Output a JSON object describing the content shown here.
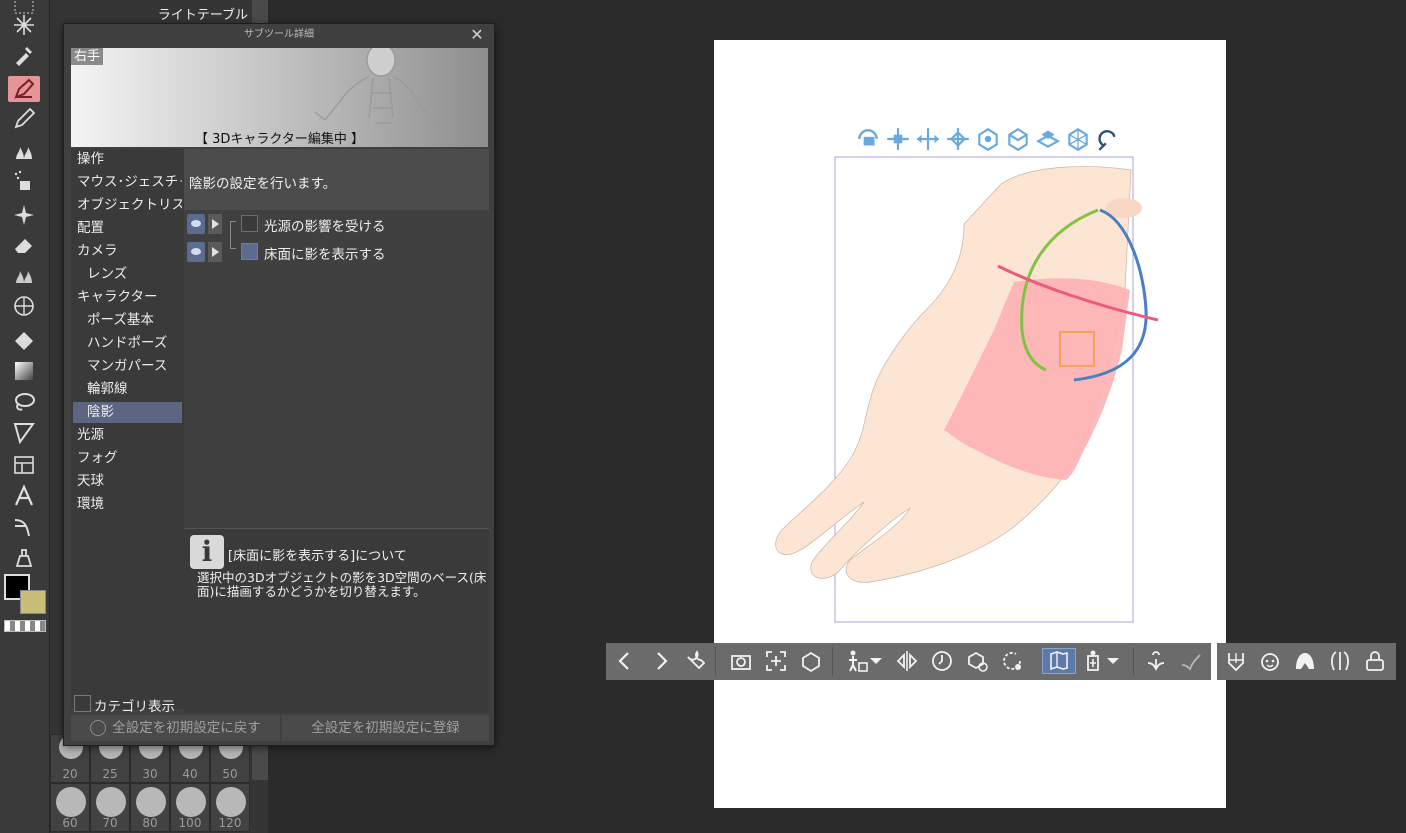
{
  "subtool_panel": {
    "light_table_label": "ライトテーブル",
    "brush_sizes_row1": [
      "20",
      "25",
      "30",
      "40",
      "50"
    ],
    "brush_sizes_row2": [
      "60",
      "70",
      "80",
      "100",
      "120"
    ]
  },
  "dialog": {
    "title": "サブツール詳細",
    "close_symbol": "✕",
    "preview_label": "右手",
    "preview_caption": "【 3Dキャラクター編集中 】",
    "categories": [
      {
        "label": "操作",
        "sub": false
      },
      {
        "label": "マウス･ジェスチャー",
        "sub": false
      },
      {
        "label": "オブジェクトリスト",
        "sub": false
      },
      {
        "label": "配置",
        "sub": false
      },
      {
        "label": "カメラ",
        "sub": false
      },
      {
        "label": "レンズ",
        "sub": true
      },
      {
        "label": "キャラクター",
        "sub": false
      },
      {
        "label": "ポーズ基本",
        "sub": true
      },
      {
        "label": "ハンドポーズ",
        "sub": true
      },
      {
        "label": "マンガパース",
        "sub": true
      },
      {
        "label": "輪郭線",
        "sub": true
      },
      {
        "label": "陰影",
        "sub": true,
        "selected": true
      },
      {
        "label": "光源",
        "sub": false
      },
      {
        "label": "フォグ",
        "sub": false
      },
      {
        "label": "天球",
        "sub": false
      },
      {
        "label": "環境",
        "sub": false
      }
    ],
    "description": "陰影の設定を行います。",
    "settings": [
      {
        "label": "光源の影響を受ける",
        "checked": false
      },
      {
        "label": "床面に影を表示する",
        "checked": true
      }
    ],
    "info_title": "[床面に影を表示する]について",
    "info_body": "選択中の3Dオブジェクトの影を3D空間のベース(床面)に描画するかどうかを切り替えます。",
    "category_toggle_label": "カテゴリ表示",
    "reset_button": "全設定を初期設定に戻す",
    "register_button": "全設定を初期設定に登録"
  },
  "colors": {
    "accent_selected": "#5d6680",
    "active_tool": "#e59498",
    "gizmo_blue": "#6aa9dd",
    "hand_skin": "#fde5d4",
    "shadow_pink": "#fdb1b4"
  },
  "icons": {
    "toolbar": [
      "select-icon",
      "wand-icon",
      "eyedropper-icon",
      "pen-icon",
      "pencil-icon",
      "brush-icon",
      "airbrush-icon",
      "decoration-icon",
      "eraser-icon",
      "blend-icon",
      "figure-icon",
      "fill-icon",
      "gradient-icon",
      "lasso-icon",
      "frame-icon",
      "balloon-icon",
      "text-icon",
      "ruler-icon",
      "object-icon"
    ],
    "gizmo": [
      "camera-rotate-icon",
      "camera-pan-icon",
      "camera-dolly-icon",
      "move-icon",
      "rotate-xy-icon",
      "rotate-y-icon",
      "rotate-plane-icon",
      "rotate-all-icon",
      "snap-icon"
    ],
    "command_bar": [
      "prev-icon",
      "next-icon",
      "wrench-icon",
      "camera-icon",
      "fit-icon",
      "ground-icon",
      "pose-add-icon",
      "mirror-icon",
      "clock-icon",
      "save-object-icon",
      "reset-rotation-icon",
      "floor-icon",
      "body-shape-icon",
      "hand-pose-icon",
      "hand-fix-icon",
      "head-icon",
      "face-icon",
      "hair-icon",
      "body-icon",
      "lock-icon"
    ]
  }
}
